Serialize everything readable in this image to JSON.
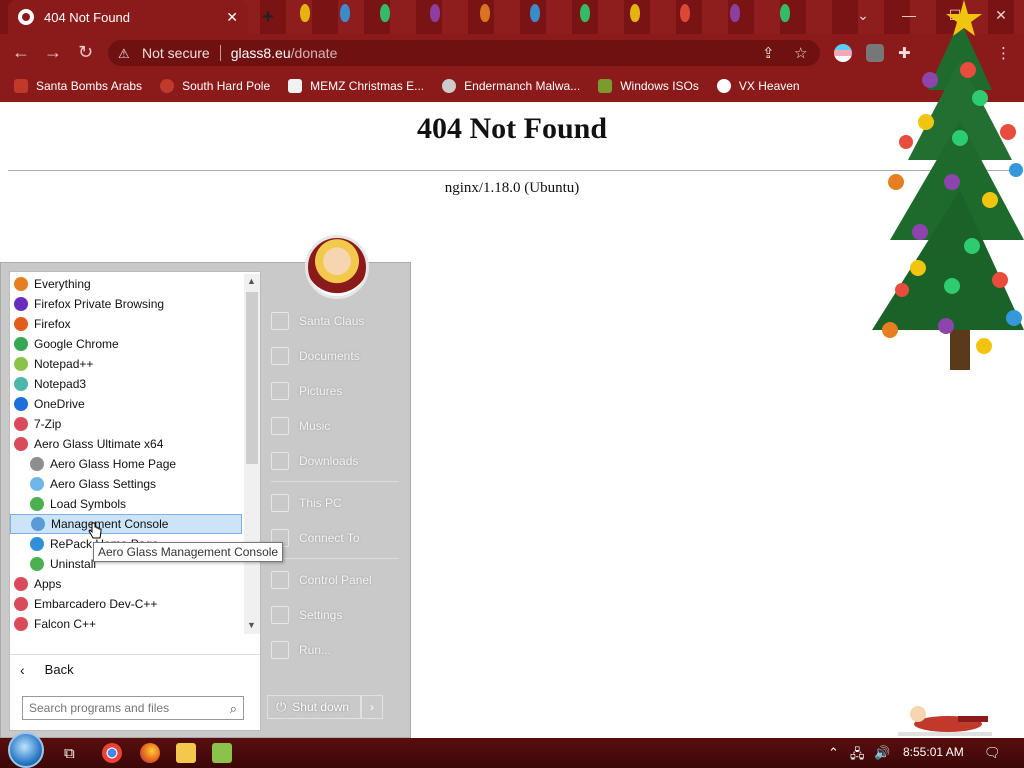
{
  "browser": {
    "tab_title": "404 Not Found",
    "tab_close": "✕",
    "new_tab": "+",
    "security_label": "Not secure",
    "url_host": "glass8.eu",
    "url_path": "/donate",
    "window_controls": {
      "minimize": "—",
      "maximize": "☐",
      "close": "✕",
      "tab_search": "⌄"
    }
  },
  "bookmarks": [
    {
      "label": "Santa Bombs Arabs",
      "color": "#c0392b"
    },
    {
      "label": "South Hard Pole",
      "color": "#c0392b"
    },
    {
      "label": "MEMZ Christmas E...",
      "color": "#f2f2f2"
    },
    {
      "label": "Endermanch Malwa...",
      "color": "#cccccc"
    },
    {
      "label": "Windows ISOs",
      "color": "#7a9c2e"
    },
    {
      "label": "VX Heaven",
      "color": "#ffffff"
    }
  ],
  "page": {
    "heading": "404 Not Found",
    "server": "nginx/1.18.0 (Ubuntu)"
  },
  "start_menu": {
    "apps": [
      {
        "label": "Everything",
        "icon": "magnifier-icon",
        "color": "#e67e22",
        "sub": false
      },
      {
        "label": "Firefox Private Browsing",
        "icon": "private-mask-icon",
        "color": "#6a2bbf",
        "sub": false
      },
      {
        "label": "Firefox",
        "icon": "firefox-icon",
        "color": "#e25c1b",
        "sub": false
      },
      {
        "label": "Google Chrome",
        "icon": "chrome-icon",
        "color": "#34a853",
        "sub": false
      },
      {
        "label": "Notepad++",
        "icon": "notepadpp-icon",
        "color": "#8bc34a",
        "sub": false
      },
      {
        "label": "Notepad3",
        "icon": "notepad3-icon",
        "color": "#4db6ac",
        "sub": false
      },
      {
        "label": "OneDrive",
        "icon": "cloud-icon",
        "color": "#1e6fd9",
        "sub": false
      },
      {
        "label": "7-Zip",
        "icon": "folder-group-icon",
        "color": "#d94a5b",
        "sub": false
      },
      {
        "label": "Aero Glass Ultimate x64",
        "icon": "folder-group-icon",
        "color": "#d94a5b",
        "sub": false
      },
      {
        "label": "Aero Glass Home Page",
        "icon": "webpage-icon",
        "color": "#8e8e8e",
        "sub": true
      },
      {
        "label": "Aero Glass Settings",
        "icon": "settings-window-icon",
        "color": "#6fb7e8",
        "sub": true
      },
      {
        "label": "Load Symbols",
        "icon": "symbols-icon",
        "color": "#4caf50",
        "sub": true
      },
      {
        "label": "Management Console",
        "icon": "console-icon",
        "color": "#5b9bd5",
        "sub": true,
        "selected": true
      },
      {
        "label": "RePack Home Page",
        "icon": "ie-icon",
        "color": "#2f8fd8",
        "sub": true
      },
      {
        "label": "Uninstall",
        "icon": "uninstall-icon",
        "color": "#4caf50",
        "sub": true
      },
      {
        "label": "Apps",
        "icon": "folder-group-icon",
        "color": "#d94a5b",
        "sub": false
      },
      {
        "label": "Embarcadero Dev-C++",
        "icon": "folder-group-icon",
        "color": "#d94a5b",
        "sub": false
      },
      {
        "label": "Falcon C++",
        "icon": "folder-group-icon",
        "color": "#d94a5b",
        "sub": false
      }
    ],
    "back_label": "Back",
    "search_placeholder": "Search programs and files",
    "right_items": [
      {
        "label": "Santa Claus",
        "icon": "user-folder-icon"
      },
      {
        "label": "Documents",
        "icon": "documents-icon"
      },
      {
        "label": "Pictures",
        "icon": "pictures-icon"
      },
      {
        "label": "Music",
        "icon": "music-icon"
      },
      {
        "label": "Downloads",
        "icon": "downloads-icon"
      },
      {
        "label": "This PC",
        "icon": "computer-icon",
        "sep_before": true
      },
      {
        "label": "Connect To",
        "icon": "network-icon"
      },
      {
        "label": "Control Panel",
        "icon": "control-panel-icon",
        "sep_before": true
      },
      {
        "label": "Settings",
        "icon": "gear-icon"
      },
      {
        "label": "Run...",
        "icon": "run-icon"
      }
    ],
    "shutdown_label": "Shut down",
    "tooltip": "Aero Glass Management Console"
  },
  "taskbar": {
    "clock": "8:55:01 AM"
  },
  "colors": {
    "chrome_red": "#8b1a1a",
    "selection": "#cce4f7"
  }
}
